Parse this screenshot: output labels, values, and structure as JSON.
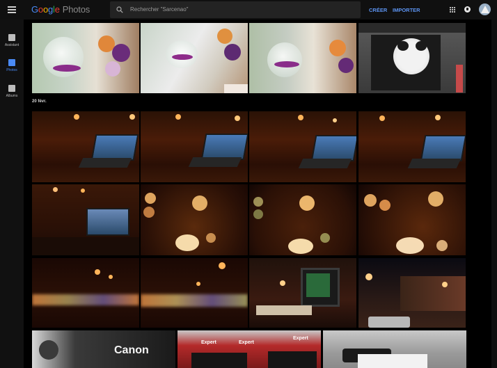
{
  "topbar": {
    "logo_letters": [
      "G",
      "o",
      "o",
      "g",
      "l",
      "e"
    ],
    "product": "Photos",
    "search_placeholder": "Rechercher \"Sarcenao\"",
    "create_label": "CRÉER",
    "import_label": "IMPORTER"
  },
  "sidebar": {
    "items": [
      {
        "label": "Assistant",
        "icon": "plus-box-icon",
        "active": false
      },
      {
        "label": "Photos",
        "icon": "photo-icon",
        "active": true
      },
      {
        "label": "Albums",
        "icon": "albums-icon",
        "active": false
      }
    ]
  },
  "library": {
    "date_label": "20 févr."
  },
  "brand_text": {
    "canon": "Canon",
    "expert": "Expert"
  },
  "colors": {
    "accent": "#4a8af4",
    "link": "#5c93f0"
  }
}
